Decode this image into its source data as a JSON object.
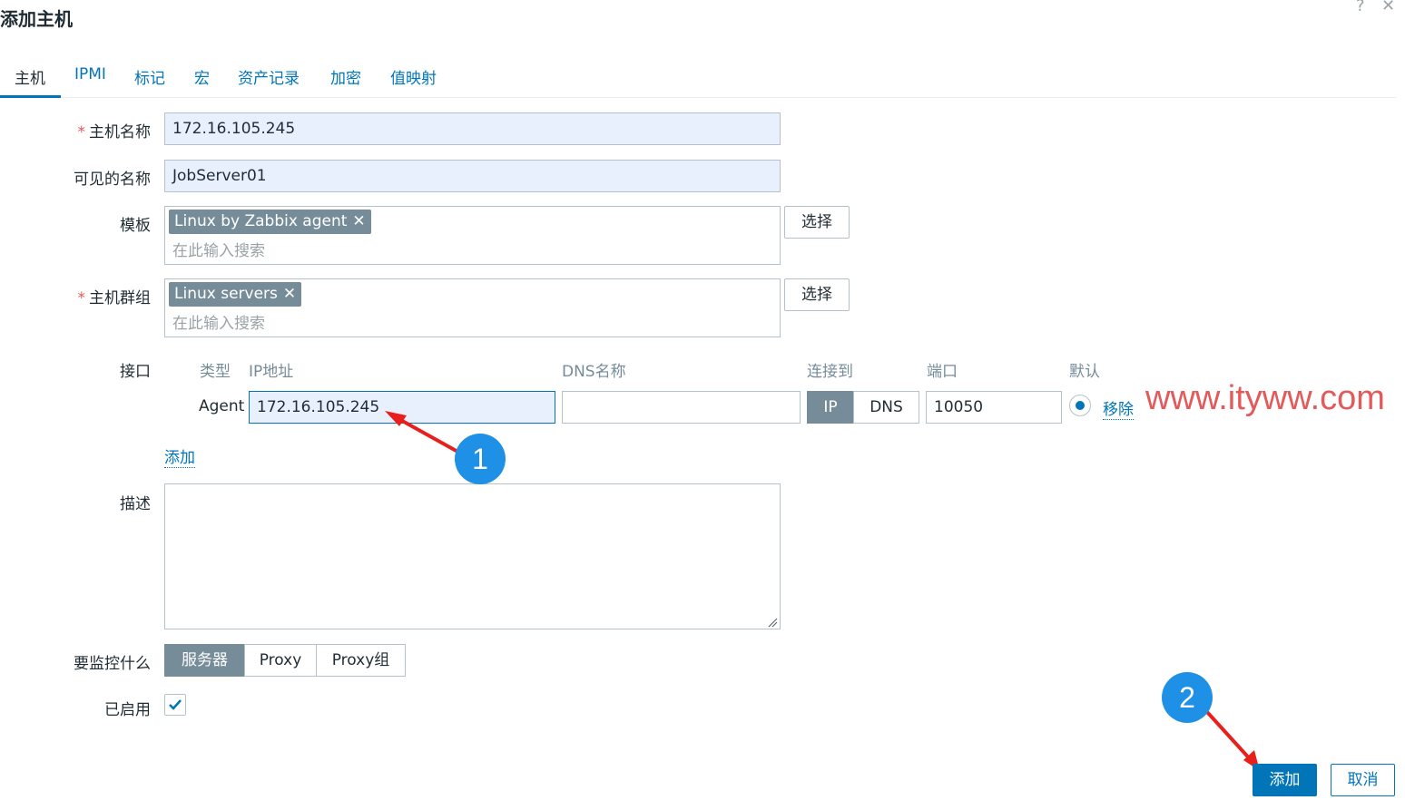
{
  "dialog": {
    "title": "添加主机",
    "help_icon": "question-icon",
    "close_icon": "close-icon",
    "help_glyph": "?",
    "close_glyph": "✕"
  },
  "tabs": [
    {
      "label": "主机"
    },
    {
      "label": "IPMI"
    },
    {
      "label": "标记"
    },
    {
      "label": "宏"
    },
    {
      "label": "资产记录"
    },
    {
      "label": "加密"
    },
    {
      "label": "值映射"
    }
  ],
  "form": {
    "required_mark": "*",
    "host_name_label": "主机名称",
    "host_name_value": "172.16.105.245",
    "visible_name_label": "可见的名称",
    "visible_name_value": "JobServer01",
    "templates_label": "模板",
    "templates_chip": "Linux by Zabbix agent",
    "templates_placeholder": "在此输入搜索",
    "templates_select": "选择",
    "groups_label": "主机群组",
    "groups_chip": "Linux servers",
    "groups_placeholder": "在此输入搜索",
    "groups_select": "选择",
    "chip_remove": "✕",
    "interfaces_label": "接口",
    "interface_headers": {
      "type": "类型",
      "ip": "IP地址",
      "dns": "DNS名称",
      "connect_to": "连接到",
      "port": "端口",
      "default": "默认"
    },
    "interface": {
      "type": "Agent",
      "ip": "172.16.105.245",
      "dns": "",
      "connect_ip": "IP",
      "connect_dns": "DNS",
      "port": "10050",
      "remove": "移除"
    },
    "add_interface": "添加",
    "description_label": "描述",
    "description_value": "",
    "monitor_label": "要监控什么",
    "monitor_options": [
      "服务器",
      "Proxy",
      "Proxy组"
    ],
    "enabled_label": "已启用",
    "enabled": true
  },
  "annotations": {
    "watermark": "www.ityww.com",
    "step1": "1",
    "step2": "2",
    "arrow_color": "#e8201c",
    "badge_color": "#1e90e6"
  },
  "footer": {
    "add": "添加",
    "cancel": "取消"
  },
  "colors": {
    "accent": "#0275b8",
    "chip": "#768d99",
    "required": "#e45959",
    "input_fill": "#e8f0fe"
  }
}
